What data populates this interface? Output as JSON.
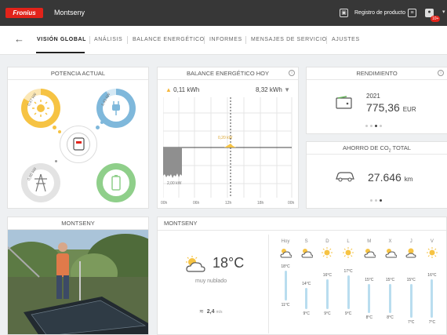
{
  "header": {
    "brand": "Fronius",
    "site_name": "Montseny",
    "product_registration": "Registro de producto",
    "badge": "10+"
  },
  "nav": {
    "tabs": [
      "VISIÓN GLOBAL",
      "ANÁLISIS",
      "BALANCE ENERGÉTICO",
      "INFORMES",
      "MENSAJES DE SERVICIO",
      "AJUSTES"
    ]
  },
  "power": {
    "title": "POTENCIA ACTUAL",
    "solar": "0,47 kW",
    "consumption": "1,43 kW",
    "grid": "0,96 kW",
    "colors": {
      "solar": "#f6c343",
      "consumption": "#7fb8db",
      "battery": "#8fcf8a",
      "grid": "#bdbdbd"
    }
  },
  "balance": {
    "title": "BALANCE ENERGÉTICO HOY",
    "produced": "0,11 kWh",
    "consumed": "8,32 kWh",
    "y_label": "2,00 kW",
    "marker": "0,20 kW",
    "x_ticks": [
      "00h",
      "06h",
      "12h",
      "18h",
      "00h"
    ]
  },
  "yield": {
    "title": "RENDIMIENTO",
    "year": "2021",
    "value": "775,36",
    "unit": "EUR"
  },
  "co2": {
    "title_prefix": "AHORRO DE CO",
    "title_sub": "2",
    "title_suffix": " TOTAL",
    "value": "27.646",
    "unit": "km"
  },
  "photo": {
    "title": "MONTSENY"
  },
  "weather": {
    "title": "MONTSENY",
    "temperature": "18°C",
    "condition": "muy nublado",
    "wind": "2,4",
    "wind_unit": "m/s",
    "days": [
      {
        "label": "Hoy",
        "high": "18°C",
        "low": "11°C",
        "icon": "cloud-icon"
      },
      {
        "label": "S",
        "high": "14°C",
        "low": "9°C",
        "icon": "cloud-icon"
      },
      {
        "label": "D",
        "high": "16°C",
        "low": "9°C",
        "icon": "sun-icon"
      },
      {
        "label": "L",
        "high": "17°C",
        "low": "9°C",
        "icon": "sun-icon"
      },
      {
        "label": "M",
        "high": "15°C",
        "low": "8°C",
        "icon": "cloud-icon"
      },
      {
        "label": "X",
        "high": "15°C",
        "low": "8°C",
        "icon": "cloud-icon"
      },
      {
        "label": "J",
        "high": "15°C",
        "low": "7°C",
        "icon": "partly-sunny-icon"
      },
      {
        "label": "V",
        "high": "16°C",
        "low": "7°C",
        "icon": "sun-icon"
      }
    ]
  }
}
